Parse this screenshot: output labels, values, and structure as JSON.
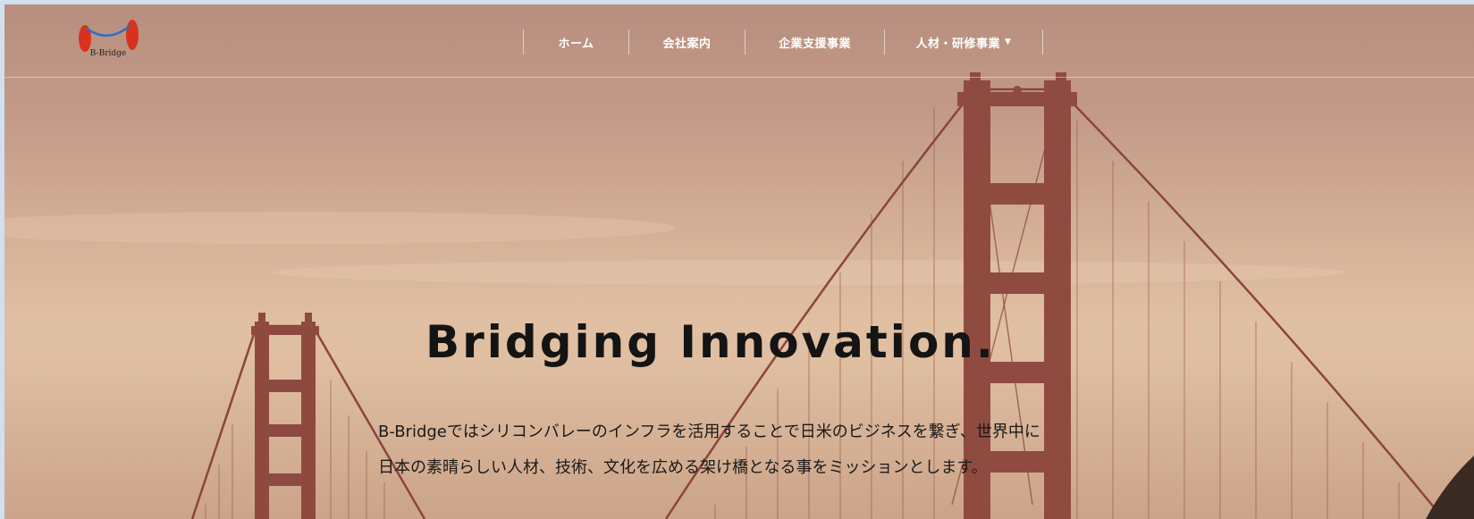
{
  "brand": {
    "logo_text": "B-Bridge"
  },
  "nav": {
    "items": [
      {
        "label": "ホーム"
      },
      {
        "label": "会社案内"
      },
      {
        "label": "企業支援事業"
      },
      {
        "label": "人材・研修事業",
        "has_dropdown": true
      }
    ]
  },
  "hero": {
    "headline": "Bridging Innovation.",
    "mission_line1": "B-Bridgeではシリコンバレーのインフラを活用することで日米のビジネスを繋ぎ、世界中に",
    "mission_line2": "日本の素晴らしい人材、技術、文化を広める架け橋となる事をミッションとします。"
  },
  "colors": {
    "sky_top": "#b88f7f",
    "sky_mid": "#d8b597",
    "bridge": "#8f4a40",
    "headline": "#141414",
    "nav_text": "#ffffff",
    "logo_red": "#d8321e",
    "logo_blue": "#2e6fc8"
  }
}
